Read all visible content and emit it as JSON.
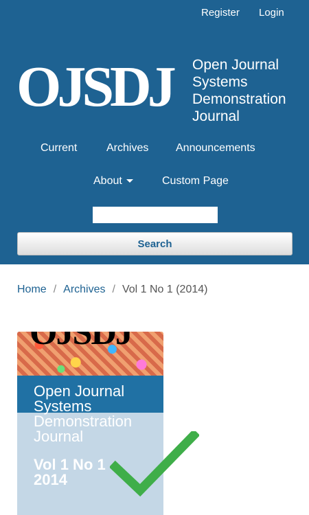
{
  "user_nav": {
    "register": "Register",
    "login": "Login"
  },
  "logo": {
    "abbr": "OJSDJ",
    "lines": [
      "Open Journal",
      "Systems",
      "Demonstration",
      "Journal"
    ]
  },
  "nav": {
    "current": "Current",
    "archives": "Archives",
    "announcements": "Announcements",
    "about": "About",
    "custom_page": "Custom Page"
  },
  "search": {
    "button": "Search"
  },
  "breadcrumb": {
    "home": "Home",
    "archives": "Archives",
    "current": "Vol 1 No 1 (2014)"
  },
  "cover": {
    "logo_text": "OJSDJ",
    "title_lines": [
      "Open Journal",
      "Systems",
      "Demonstration",
      "Journal"
    ],
    "issue_lines": [
      "Vol 1 No 1",
      "2014"
    ]
  },
  "colors": {
    "header_bg": "#1e6292",
    "check": "#3fae49"
  }
}
